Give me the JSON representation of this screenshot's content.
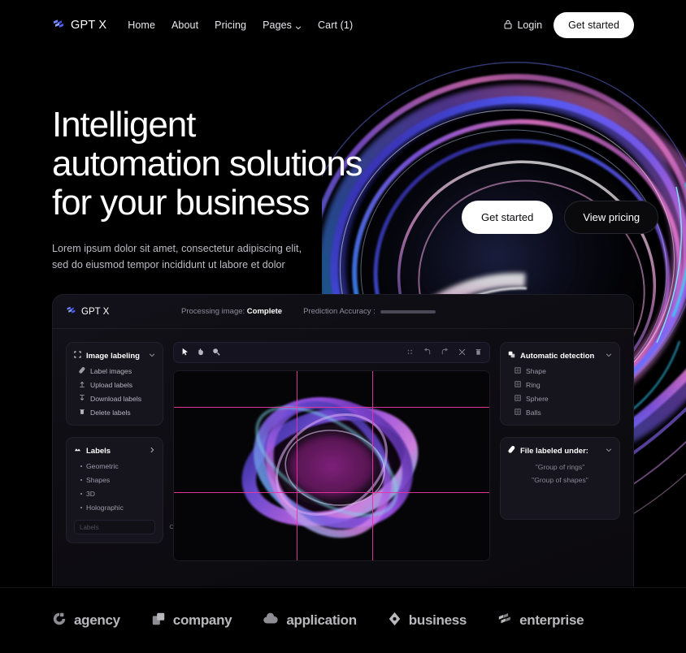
{
  "brand": {
    "name": "GPT X",
    "logo_icon": "gptx-logo-icon"
  },
  "nav": {
    "links": [
      {
        "label": "Home",
        "has_caret": false
      },
      {
        "label": "About",
        "has_caret": false
      },
      {
        "label": "Pricing",
        "has_caret": false
      },
      {
        "label": "Pages",
        "has_caret": true
      },
      {
        "label": "Cart (1)",
        "has_caret": false
      }
    ],
    "login_label": "Login",
    "login_icon": "lock-icon",
    "cta_label": "Get started"
  },
  "hero": {
    "title_line1": "Intelligent",
    "title_line2": "automation solutions",
    "title_line3": "for your business",
    "subtitle_line1": "Lorem ipsum dolor sit amet, consectetur adipiscing elit,",
    "subtitle_line2": "sed do eiusmod tempor incididunt ut labore et dolor",
    "primary_cta": "Get started",
    "secondary_cta": "View pricing"
  },
  "app": {
    "brand_name": "GPT X",
    "processing_label": "Processing image:",
    "processing_value": "Complete",
    "accuracy_label": "Prediction Accuracy :",
    "accuracy_percent": 75,
    "image_labeling": {
      "title": "Image labeling",
      "caret_icon": "chevron-down-icon",
      "header_icon": "crop-frame-icon",
      "items": [
        {
          "label": "Label images",
          "icon": "tag-icon"
        },
        {
          "label": "Upload labels",
          "icon": "upload-icon"
        },
        {
          "label": "Download labels",
          "icon": "download-icon"
        },
        {
          "label": "Delete labels",
          "icon": "trash-icon"
        }
      ]
    },
    "labels": {
      "title": "Labels",
      "caret_icon": "chevron-right-icon",
      "header_icon": "layers-icon",
      "items": [
        "Geometric",
        "Shapes",
        "3D",
        "Holographic"
      ],
      "search_placeholder": "Labels",
      "search_value": "",
      "search_icon": "search-icon"
    },
    "toolbar": {
      "left_tools": [
        {
          "name": "cursor-tool",
          "icon": "cursor-arrow-icon"
        },
        {
          "name": "hand-tool",
          "icon": "hand-icon"
        },
        {
          "name": "zoom-tool",
          "icon": "magnifier-icon"
        }
      ],
      "right_tools": [
        {
          "name": "grid-handle",
          "icon": "grid-dots-icon"
        },
        {
          "name": "undo",
          "icon": "undo-icon"
        },
        {
          "name": "redo",
          "icon": "redo-icon"
        },
        {
          "name": "close",
          "icon": "close-x-icon"
        },
        {
          "name": "delete",
          "icon": "trash-icon"
        }
      ]
    },
    "automatic_detection": {
      "title": "Automatic detection",
      "caret_icon": "chevron-down-icon",
      "header_icon": "copy-shapes-icon",
      "items": [
        "Shape",
        "Ring",
        "Sphere",
        "Balls"
      ]
    },
    "file_labeled_under": {
      "title": "File labeled under:",
      "caret_icon": "chevron-down-icon",
      "header_icon": "tag-icon",
      "values": [
        "\"Group of rings\"",
        "\"Group of shapes\""
      ]
    }
  },
  "logos": [
    {
      "label": "agency",
      "icon": "ring-segment-icon"
    },
    {
      "label": "company",
      "icon": "two-squares-icon"
    },
    {
      "label": "application",
      "icon": "cloud-icon"
    },
    {
      "label": "business",
      "icon": "diamond-icon"
    },
    {
      "label": "enterprise",
      "icon": "blocks-icon"
    }
  ],
  "colors": {
    "accent_blue": "#4c63ff",
    "accent_violet": "#8b5cf6",
    "accent_magenta": "#e3379f",
    "page_bg": "#000000",
    "panel_bg": "#131119"
  }
}
